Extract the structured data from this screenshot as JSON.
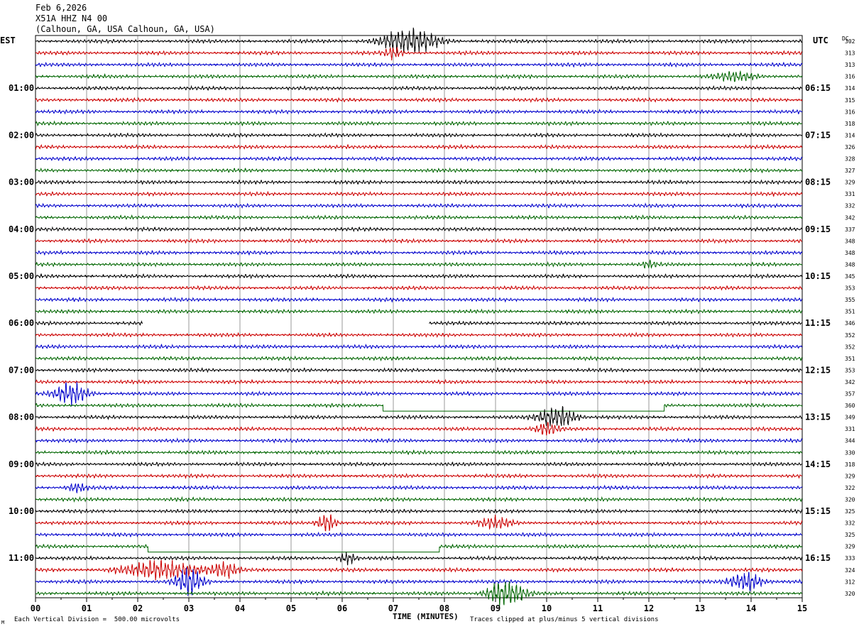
{
  "header": {
    "date": "Feb 6,2026",
    "station": "X51A HHZ N4 00",
    "location": "(Calhoun, GA, USA Calhoun, GA, USA)"
  },
  "labels": {
    "left_tz": "EST",
    "right_tz": "UTC",
    "dc_header": "DC",
    "xlabel": "TIME (MINUTES)",
    "scale_note": "Each Vertical Division =  500.00 microvolts",
    "clip_note": "Traces clipped at plus/minus 5 vertical divisions",
    "corner_mark": "M"
  },
  "colors": {
    "trace_cycle": [
      "#000000",
      "#cc0000",
      "#0000cc",
      "#006600"
    ],
    "grid": "#000000",
    "background": "#ffffff"
  },
  "chart_data": {
    "type": "line",
    "description_kind": "helicorder",
    "minutes_per_line": 15,
    "line_count": 48,
    "x": {
      "min": 0,
      "max": 15,
      "ticks": [
        "00",
        "01",
        "02",
        "03",
        "04",
        "05",
        "06",
        "07",
        "08",
        "09",
        "10",
        "11",
        "12",
        "13",
        "14",
        "15"
      ]
    },
    "left_hour_labels": [
      "01:00",
      "02:00",
      "03:00",
      "04:00",
      "05:00",
      "06:00",
      "07:00",
      "08:00",
      "09:00",
      "10:00",
      "11:00"
    ],
    "right_hour_labels": [
      "06:15",
      "07:15",
      "08:15",
      "09:15",
      "10:15",
      "11:15",
      "12:15",
      "13:15",
      "14:15",
      "15:15",
      "16:15"
    ],
    "dc_offsets": [
      "302",
      "313",
      "313",
      "316",
      "314",
      "315",
      "316",
      "318",
      "314",
      "326",
      "328",
      "327",
      "329",
      "331",
      "332",
      "342",
      "337",
      "348",
      "348",
      "348",
      "345",
      "353",
      "355",
      "351",
      "346",
      "352",
      "352",
      "351",
      "353",
      "342",
      "357",
      "360",
      "349",
      "331",
      "344",
      "330",
      "318",
      "329",
      "322",
      "320",
      "325",
      "332",
      "325",
      "329",
      "333",
      "324",
      "312",
      "320"
    ],
    "events": [
      {
        "line": 0,
        "minute": 7.3,
        "duration": 1.3,
        "amplitude": 2.6
      },
      {
        "line": 1,
        "minute": 7.0,
        "duration": 0.4,
        "amplitude": 1.2
      },
      {
        "line": 3,
        "minute": 13.7,
        "duration": 1.0,
        "amplitude": 1.0
      },
      {
        "line": 19,
        "minute": 12.0,
        "duration": 0.3,
        "amplitude": 0.8
      },
      {
        "line": 30,
        "minute": 0.7,
        "duration": 0.7,
        "amplitude": 2.5
      },
      {
        "line": 32,
        "minute": 10.2,
        "duration": 0.8,
        "amplitude": 2.6
      },
      {
        "line": 33,
        "minute": 10.0,
        "duration": 0.5,
        "amplitude": 1.4
      },
      {
        "line": 38,
        "minute": 0.8,
        "duration": 0.4,
        "amplitude": 1.0
      },
      {
        "line": 41,
        "minute": 5.7,
        "duration": 0.4,
        "amplitude": 2.2
      },
      {
        "line": 41,
        "minute": 9.0,
        "duration": 0.7,
        "amplitude": 1.3
      },
      {
        "line": 44,
        "minute": 6.1,
        "duration": 0.4,
        "amplitude": 1.3
      },
      {
        "line": 45,
        "minute": 2.5,
        "duration": 1.8,
        "amplitude": 2.0
      },
      {
        "line": 45,
        "minute": 3.7,
        "duration": 0.6,
        "amplitude": 1.6
      },
      {
        "line": 46,
        "minute": 3.0,
        "duration": 0.6,
        "amplitude": 3.0
      },
      {
        "line": 46,
        "minute": 13.9,
        "duration": 0.7,
        "amplitude": 2.2
      },
      {
        "line": 47,
        "minute": 9.2,
        "duration": 0.8,
        "amplitude": 3.0
      }
    ],
    "gaps": [
      {
        "line": 24,
        "start": 2.1,
        "end": 7.7
      },
      {
        "line": 31,
        "start": 6.8,
        "end": 12.3
      },
      {
        "line": 43,
        "start": 2.2,
        "end": 5.0
      },
      {
        "line": 43,
        "start": 5.0,
        "end": 7.9
      }
    ]
  }
}
